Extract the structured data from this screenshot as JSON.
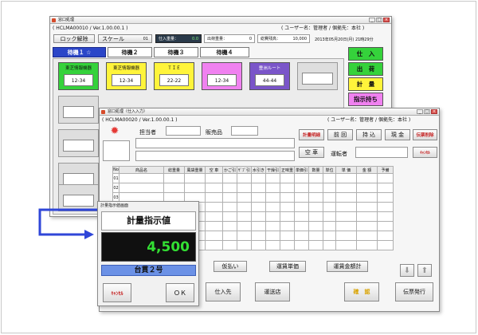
{
  "main_window": {
    "title": "窓口処理",
    "version": "( HCLMA00010 / Ver.1.00.00.1 )",
    "user": "( ユーザー名：管理者 / 個拠先：本社 )",
    "lock_btn": "ロック解除",
    "scale_label": "スケール",
    "scale_value": "01",
    "entry_w_label": "仕入重量：",
    "entry_w_value": "0.0",
    "ship_w_label": "出荷重量：",
    "ship_w_value": "0",
    "total_label": "総費残高：",
    "total_value": "10,000",
    "datetime": "2013年05月20日(月) 21時29分",
    "tabs": [
      "待機１ ☆",
      "待機２",
      "待機３",
      "待機４"
    ],
    "tiles": [
      {
        "title": "東芝情報機器",
        "value": "12-34"
      },
      {
        "title": "東芝情報機器",
        "value": "12-34"
      },
      {
        "title": "ＴＩＥ",
        "value": "22-22"
      },
      {
        "title": "",
        "value": "12-34"
      },
      {
        "title": "豊洲ルート",
        "value": "44-44"
      }
    ],
    "side_buttons": [
      "仕　入",
      "出　荷",
      "計　量",
      "指示持ち"
    ]
  },
  "order_window": {
    "title": "窓口処理（仕入入力）",
    "version": "( HCLMA00020 / Ver.1.00.00.1 )",
    "user": "( ユーザー名：管理者 / 個拠先：本社 )",
    "person_label": "担当者",
    "category_label": "販売品",
    "buttons_row1": [
      "計量明細",
      "前 回",
      "持 込",
      "現 金",
      "伝票削除"
    ],
    "cancel_small": "ｷｬﾝｾﾙ",
    "empty_btn": "空 車",
    "driver_label": "運転者",
    "columns": [
      "No",
      "商品名",
      "総重量",
      "風袋重量",
      "空 車",
      "かご引",
      "ｻﾞﾌﾞ引",
      "水引き",
      "干燥引",
      "正味重",
      "単価引",
      "数量",
      "単位",
      "単 価",
      "金 額",
      "予備"
    ],
    "row_labels": [
      "01",
      "02",
      "03"
    ],
    "bottom_buttons": [
      "仮払い",
      "運賃単価",
      "運賃金額計"
    ],
    "footer_buttons": [
      "仕入先",
      "運送店",
      "確　認",
      "伝票発行"
    ]
  },
  "popup": {
    "title": "計量指示値画面",
    "header": "計量指示値",
    "value": "4,500",
    "vehicle": "台貫２号",
    "cancel": "ｷｬﾝｾﾙ",
    "ok": "ＯＫ"
  },
  "colors": {
    "tab_active": "#2b46c8",
    "green": "#35d23b",
    "yellow": "#fff43b",
    "magenta": "#f081f0",
    "purple": "#7a55c9",
    "blue_tile": "#1e6ae0",
    "connector": "#2f46d8",
    "display_bg": "#101010",
    "display_fg": "#33e033",
    "plate_bg": "#6b91e6"
  }
}
